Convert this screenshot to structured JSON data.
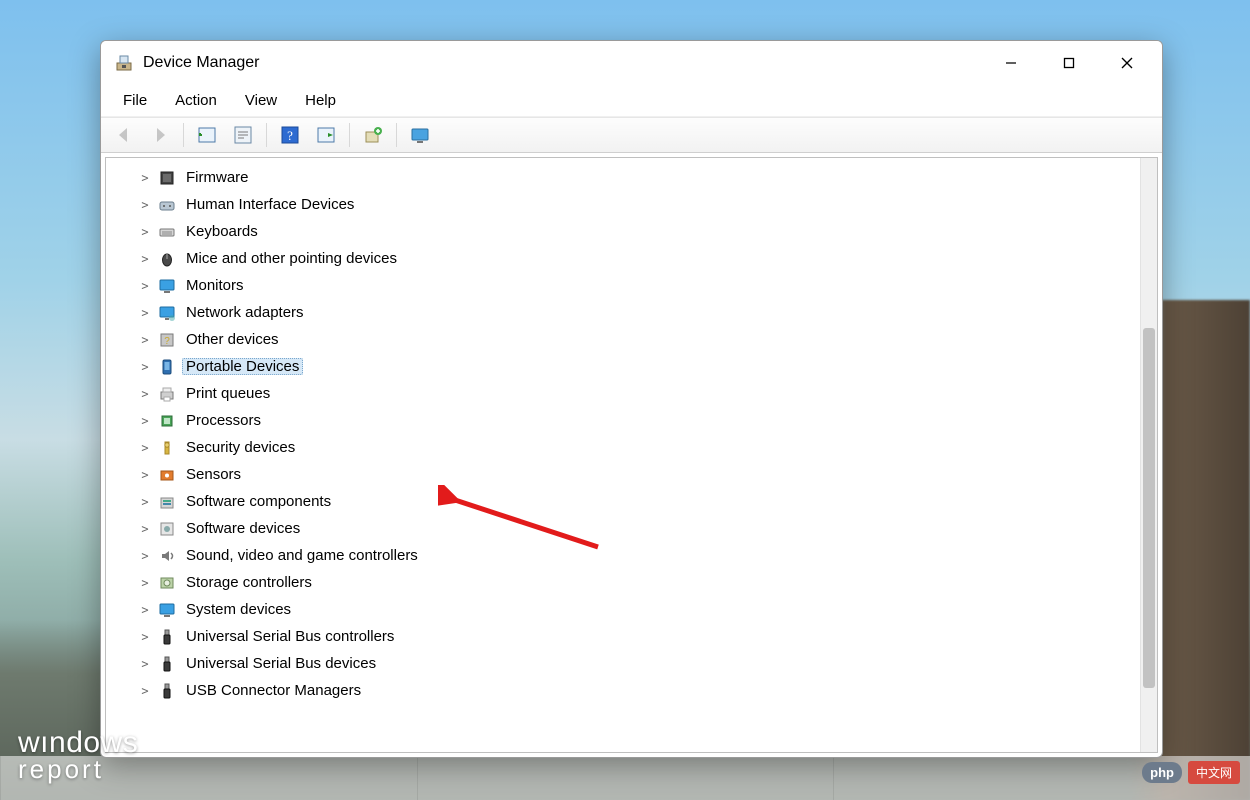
{
  "window": {
    "title": "Device Manager"
  },
  "menubar": [
    "File",
    "Action",
    "View",
    "Help"
  ],
  "toolbar": [
    {
      "name": "back",
      "enabled": false
    },
    {
      "name": "forward",
      "enabled": false
    },
    {
      "sep": true
    },
    {
      "name": "show-hidden",
      "enabled": true
    },
    {
      "name": "properties",
      "enabled": true
    },
    {
      "sep": true
    },
    {
      "name": "help",
      "enabled": true
    },
    {
      "name": "scan-hardware",
      "enabled": true
    },
    {
      "sep": true
    },
    {
      "name": "add-legacy",
      "enabled": true
    },
    {
      "sep": true
    },
    {
      "name": "devices-view",
      "enabled": true
    }
  ],
  "tree": [
    {
      "icon": "firmware",
      "label": "Firmware",
      "selected": false
    },
    {
      "icon": "hid",
      "label": "Human Interface Devices",
      "selected": false
    },
    {
      "icon": "keyboard",
      "label": "Keyboards",
      "selected": false
    },
    {
      "icon": "mouse",
      "label": "Mice and other pointing devices",
      "selected": false
    },
    {
      "icon": "monitor",
      "label": "Monitors",
      "selected": false
    },
    {
      "icon": "network",
      "label": "Network adapters",
      "selected": false
    },
    {
      "icon": "other",
      "label": "Other devices",
      "selected": false
    },
    {
      "icon": "portable",
      "label": "Portable Devices",
      "selected": true
    },
    {
      "icon": "printer",
      "label": "Print queues",
      "selected": false
    },
    {
      "icon": "cpu",
      "label": "Processors",
      "selected": false
    },
    {
      "icon": "security",
      "label": "Security devices",
      "selected": false
    },
    {
      "icon": "sensors",
      "label": "Sensors",
      "selected": false
    },
    {
      "icon": "swcomp",
      "label": "Software components",
      "selected": false
    },
    {
      "icon": "swdev",
      "label": "Software devices",
      "selected": false
    },
    {
      "icon": "sound",
      "label": "Sound, video and game controllers",
      "selected": false
    },
    {
      "icon": "storage",
      "label": "Storage controllers",
      "selected": false
    },
    {
      "icon": "system",
      "label": "System devices",
      "selected": false
    },
    {
      "icon": "usb",
      "label": "Universal Serial Bus controllers",
      "selected": false
    },
    {
      "icon": "usb",
      "label": "Universal Serial Bus devices",
      "selected": false
    },
    {
      "icon": "usb",
      "label": "USB Connector Managers",
      "selected": false
    }
  ],
  "watermark": {
    "line1a": "w",
    "line1b": "ındows",
    "line2": "report"
  },
  "badge": {
    "left": "php",
    "right": "中文网"
  }
}
